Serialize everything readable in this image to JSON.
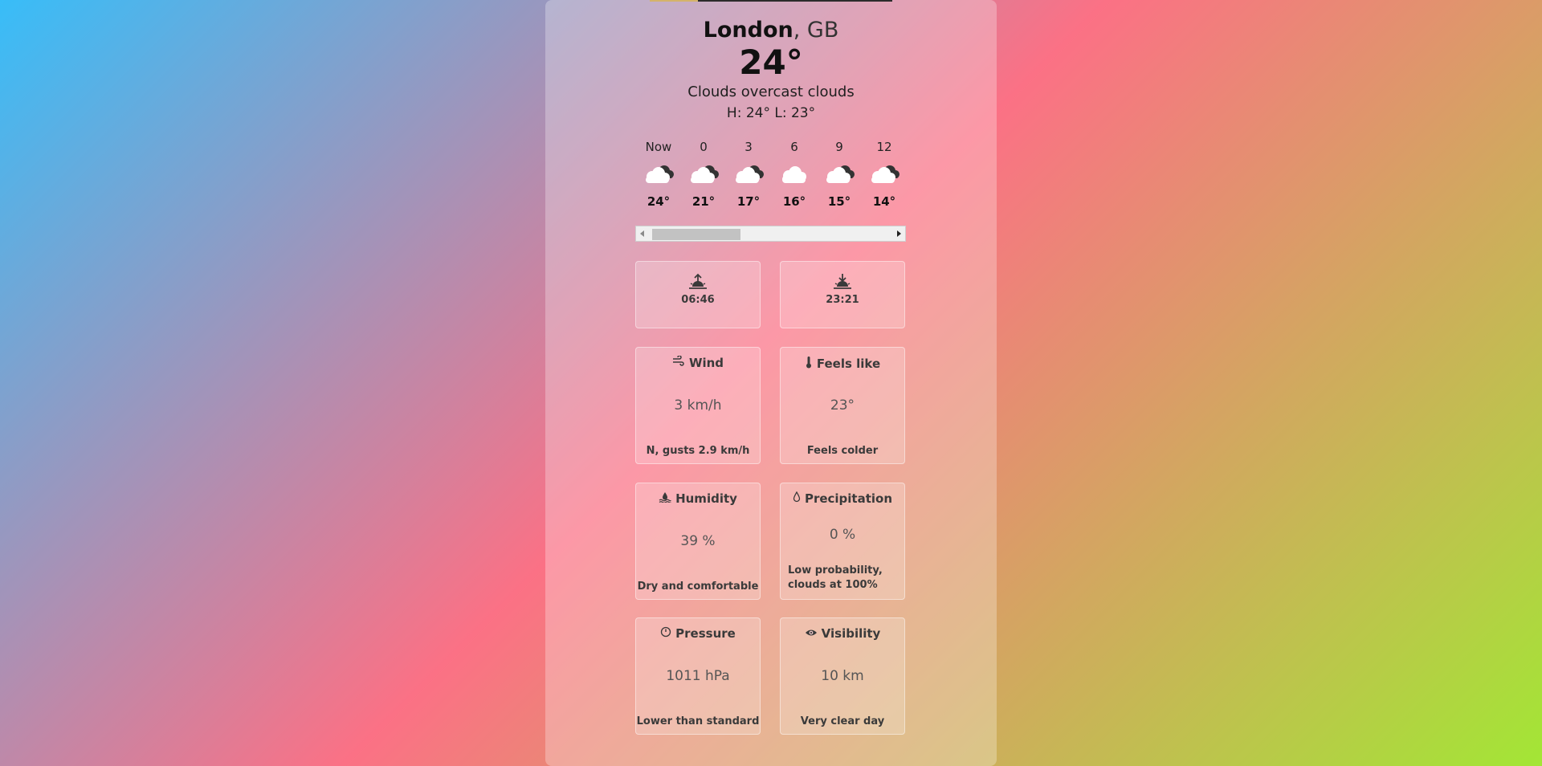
{
  "location": {
    "city": "London",
    "separator": ", ",
    "country": "GB"
  },
  "current": {
    "temperature": "24°",
    "description": "Clouds overcast clouds",
    "hi_lo": "H: 24° L: 23°"
  },
  "hourly": [
    {
      "time": "Now",
      "temp": "24°",
      "icon": "cloud-dark-icon"
    },
    {
      "time": "0",
      "temp": "21°",
      "icon": "cloud-dark-icon"
    },
    {
      "time": "3",
      "temp": "17°",
      "icon": "cloud-dark-icon"
    },
    {
      "time": "6",
      "temp": "16°",
      "icon": "cloud-icon"
    },
    {
      "time": "9",
      "temp": "15°",
      "icon": "cloud-dark-icon"
    },
    {
      "time": "12",
      "temp": "14°",
      "icon": "cloud-dark-icon"
    }
  ],
  "sun": {
    "sunrise": "06:46",
    "sunset": "23:21"
  },
  "wind": {
    "title": "Wind",
    "value": "3 km/h",
    "note": "N, gusts 2.9 km/h"
  },
  "feels_like": {
    "title": "Feels like",
    "value": "23°",
    "note": "Feels colder"
  },
  "humidity": {
    "title": "Humidity",
    "value": "39 %",
    "note": "Dry and comfortable"
  },
  "precipitation": {
    "title": "Precipitation",
    "value": "0 %",
    "note": "Low probability, clouds at 100%"
  },
  "pressure": {
    "title": "Pressure",
    "value": "1011 hPa",
    "note": "Lower than standard"
  },
  "visibility": {
    "title": "Visibility",
    "value": "10 km",
    "note": "Very clear day"
  },
  "colors": {
    "gradient_start": "#38bdf8",
    "gradient_mid": "#fb7185",
    "gradient_end": "#a3e635"
  }
}
